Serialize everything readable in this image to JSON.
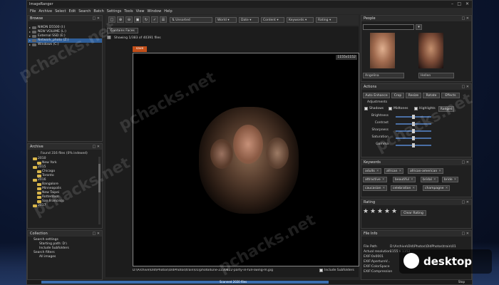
{
  "app": {
    "title": "ImageRanger"
  },
  "menu": [
    "File",
    "Archive",
    "Select",
    "Edit",
    "Search",
    "Batch",
    "Settings",
    "Tools",
    "View",
    "Window",
    "Help"
  ],
  "browse": {
    "title": "Browse",
    "drives": [
      {
        "label": "NIKON D5500 (I:)"
      },
      {
        "label": "NEW VOLUME (L:)"
      },
      {
        "label": "External SSD (E:)"
      },
      {
        "label": "Network_photo (Z:)",
        "selected": true
      },
      {
        "label": "Windows (C:)"
      }
    ]
  },
  "archive": {
    "title": "Archive",
    "found": "Found 316 files (0% indexed)",
    "items": [
      {
        "label": "2010",
        "depth": 0
      },
      {
        "label": "New York",
        "depth": 1
      },
      {
        "label": "2015",
        "depth": 0
      },
      {
        "label": "Chicago",
        "depth": 1
      },
      {
        "label": "Toronto",
        "depth": 1
      },
      {
        "label": "2016",
        "depth": 0
      },
      {
        "label": "Bangalore",
        "depth": 1
      },
      {
        "label": "Minneapolis",
        "depth": 1
      },
      {
        "label": "New Taipei",
        "depth": 1
      },
      {
        "label": "Rotterdam",
        "depth": 1
      },
      {
        "label": "San Francisco",
        "depth": 1
      },
      {
        "label": "2017",
        "depth": 0
      }
    ]
  },
  "collection": {
    "title": "Collection",
    "items": [
      {
        "label": "Search settings",
        "depth": 0
      },
      {
        "label": "Starting path: D:\\",
        "depth": 1
      },
      {
        "label": "Include Subfolders",
        "depth": 1
      },
      {
        "label": "Search filters",
        "depth": 0
      },
      {
        "label": "All images",
        "depth": 1
      }
    ]
  },
  "toolbar": {
    "sort": "Unsorted",
    "filters": [
      "World",
      "Date",
      "Content",
      "Keywords",
      "Rating"
    ]
  },
  "main": {
    "filter_chip": "Contains Faces",
    "showing": "Showing 1/383 of 40391 files",
    "save_label": "save",
    "resolution": "1155x1152",
    "path": "D:\\Archive\\Old\\Photos\\OldPhotos\\train\\01\\photodune-2230822-party-in-full-swing-m.jpg",
    "include_subfolders": "Include Subfolders"
  },
  "people": {
    "title": "People",
    "names": [
      "Angelina",
      "Hellen"
    ]
  },
  "actions": {
    "title": "Actions",
    "buttons": [
      "Auto Enhance",
      "Crop",
      "Resize",
      "Rotate",
      "Effects"
    ],
    "adjustments_label": "Adjustments",
    "checks": [
      "Shadows",
      "Midtones",
      "Highlights"
    ],
    "ranges_label": "Ranges",
    "sliders": [
      {
        "label": "Brightness",
        "value": 0.5
      },
      {
        "label": "Contrast",
        "value": 0.5
      },
      {
        "label": "Sharpness",
        "value": 0.5
      },
      {
        "label": "Saturation",
        "value": 0.5
      },
      {
        "label": "Gamma",
        "value": 0.5
      }
    ]
  },
  "keywords": {
    "title": "Keywords",
    "tags": [
      "adults",
      "african",
      "african-american",
      "attractive",
      "beautiful",
      "bridal",
      "bride",
      "caucasian",
      "celebration",
      "champagne"
    ]
  },
  "rating": {
    "title": "Rating",
    "stars": 5,
    "clear_label": "Clear Rating"
  },
  "fileinfo": {
    "title": "File Info",
    "rows": [
      {
        "k": "File Path",
        "v": "D:\\Archive\\Old\\Photos\\OldPhotos\\train\\01"
      },
      {
        "k": "Actual resolution",
        "v": "1155 x 1152"
      },
      {
        "k": "EXIF:0x0001",
        "v": ""
      },
      {
        "k": "EXIF:ApertureV...",
        "v": ""
      },
      {
        "k": "EXIF:ColorSpace",
        "v": ""
      },
      {
        "k": "EXIF:Compression",
        "v": ""
      }
    ]
  },
  "status": {
    "text": "Scanned 2020 files",
    "stop_label": "Stop",
    "progress": 0.72
  },
  "watermark": {
    "text": "pchacks.net",
    "badge": "desktop"
  }
}
